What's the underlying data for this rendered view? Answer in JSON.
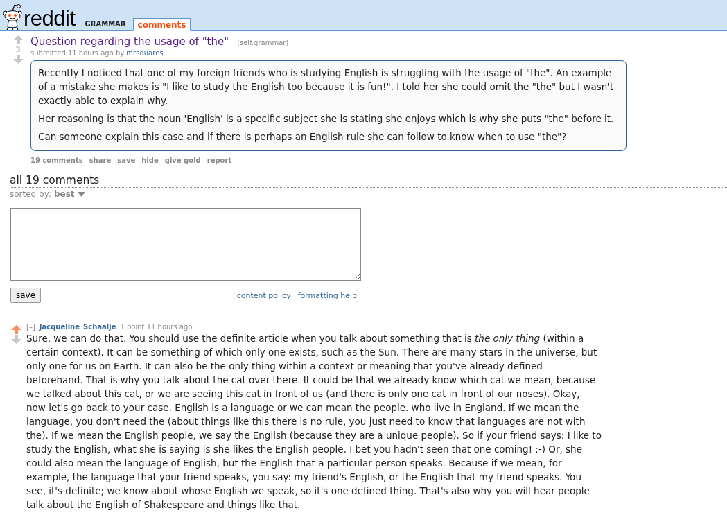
{
  "header": {
    "logo_text": "reddit",
    "subreddit": "GRAMMAR",
    "tabs": [
      {
        "label": "comments",
        "selected": true
      }
    ]
  },
  "post": {
    "upvoted": false,
    "score": "3",
    "title": "Question regarding the usage of \"the\"",
    "domain": "(self.grammar)",
    "submitted": "submitted 11 hours ago by",
    "author": "mrsquares",
    "paragraphs": [
      "Recently I noticed that one of my foreign friends who is studying English is struggling with the usage of \"the\". An example of a mistake she makes is \"I like to study the English too because it is fun!\". I told her she could omit the \"the\" but I wasn't exactly able to explain why.",
      "Her reasoning is that the noun 'English' is a specific subject she is stating she enjoys which is why she puts \"the\" before it.",
      "Can someone explain this case and if there is perhaps an English rule she can follow to know when to use \"the\"?"
    ],
    "actions": [
      "19 comments",
      "share",
      "save",
      "hide",
      "give gold",
      "report"
    ]
  },
  "comments_header": {
    "title": "all 19 comments",
    "sort_label": "sorted by:",
    "sort_value": "best"
  },
  "reply_form": {
    "save": "save",
    "links": [
      "content policy",
      "formatting help"
    ]
  },
  "comments": [
    {
      "upvoted": true,
      "collapse": "[–]",
      "author": "Jacqueline_Schaalje",
      "meta": "1 point 11 hours ago",
      "body": "Sure, we can do that. You should use the definite article when you talk about something that is *the only thing* (within a certain context). It can be something of which only one exists, such as the Sun. There are many stars in the universe, but only one for us on Earth. It can also be the only thing within a context or meaning that you've already defined beforehand. That is why you talk about the cat over there. It could be that we already know which cat we mean, because we talked about this cat, or we are seeing this cat in front of us (and there is only one cat in front of our noses). Okay, now let's go back to your case. English is a language or we can mean the people. who live in England. If we mean the language, you don't need the (about things like this there is no rule, you just need to know that languages are not with the). If we mean the English people, we say the English (because they are a unique people). So if your friend says: I like to study the English, what she is saying is she likes the English people. I bet you hadn't seen that one coming! :-) Or, she could also mean the language of English, but the English that a particular person speaks. Because if we mean, for example, the language that your friend speaks, you say: my friend's English, or the English that my friend speaks. You see, it's definite; we know about whose English we speak, so it's one defined thing. That's also why you will hear people talk about the English of Shakespeare and things like that."
    }
  ]
}
